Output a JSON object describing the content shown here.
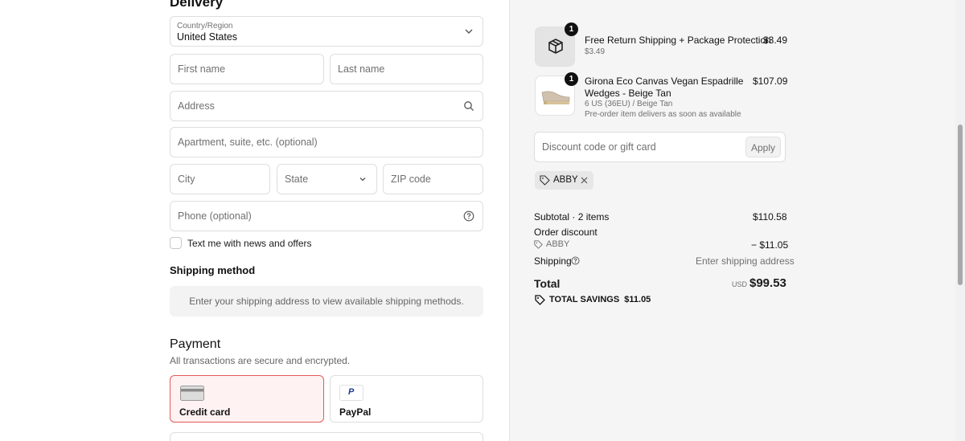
{
  "delivery": {
    "title": "Delivery",
    "country": {
      "label": "Country/Region",
      "value": "United States"
    },
    "first_name": {
      "placeholder": "First name"
    },
    "last_name": {
      "placeholder": "Last name"
    },
    "address": {
      "placeholder": "Address"
    },
    "apartment": {
      "placeholder": "Apartment, suite, etc. (optional)"
    },
    "city": {
      "placeholder": "City"
    },
    "state": {
      "placeholder": "State"
    },
    "zip": {
      "placeholder": "ZIP code"
    },
    "phone": {
      "placeholder": "Phone (optional)"
    },
    "text_offers_label": "Text me with news and offers"
  },
  "shipping_method": {
    "title": "Shipping method",
    "message": "Enter your shipping address to view available shipping methods."
  },
  "payment": {
    "title": "Payment",
    "subtitle": "All transactions are secure and encrypted.",
    "options": [
      {
        "label": "Credit card",
        "selected": true
      },
      {
        "label": "PayPal",
        "selected": false
      }
    ]
  },
  "order": {
    "items": [
      {
        "title": "Free Return Shipping + Package Protection",
        "subtitle": "$3.49",
        "price": "$3.49",
        "quantity": "1"
      },
      {
        "title_line1": "Girona Eco Canvas Vegan Espadrille",
        "title_line2": "Wedges - Beige Tan",
        "variant": "6 US (36EU) / Beige Tan",
        "note": "Pre-order item delivers as soon as available",
        "price": "$107.09",
        "quantity": "1"
      }
    ],
    "discount": {
      "placeholder": "Discount code or gift card",
      "apply_label": "Apply"
    },
    "applied_code": "ABBY",
    "summary": {
      "subtotal_label": "Subtotal · 2 items",
      "subtotal_value": "$110.58",
      "order_discount_label": "Order discount",
      "discount_code": "ABBY",
      "discount_value": "− $11.05",
      "shipping_label": "Shipping",
      "shipping_value": "Enter shipping address",
      "total_label": "Total",
      "currency": "USD",
      "total_value": "$99.53",
      "savings_label": "TOTAL SAVINGS",
      "savings_value": "$11.05"
    }
  },
  "colors": {
    "selected_border": "#e25a5a",
    "selected_bg": "#fff2f2",
    "summary_bg": "#f5f5f5",
    "badge": "#111111"
  }
}
